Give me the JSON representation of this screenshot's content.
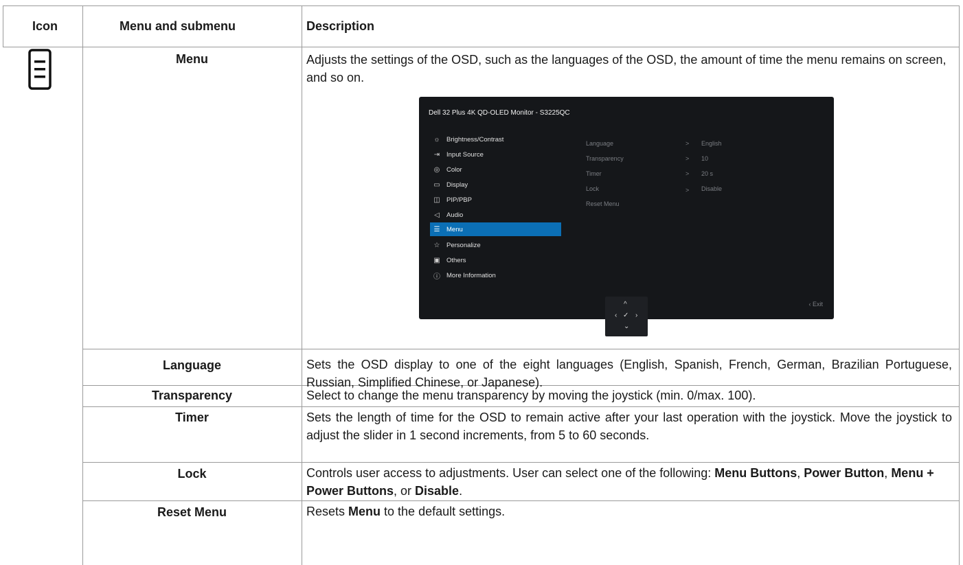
{
  "table": {
    "headers": {
      "icon": "Icon",
      "menu": "Menu and submenu",
      "description": "Description"
    },
    "menu_row": {
      "label": "Menu",
      "icon": "menu-list-icon",
      "description": "Adjusts the settings of the OSD, such as the languages of the OSD, the amount of time the menu remains on screen, and so on."
    },
    "rows": [
      {
        "label": "Language",
        "description": "Sets the OSD display to one of the eight languages (English, Spanish, French, German, Brazilian Portuguese, Russian, Simplified Chinese, or Japanese)."
      },
      {
        "label": "Transparency",
        "description": "Select to change the menu transparency by moving the joystick (min. 0/max. 100)."
      },
      {
        "label": "Timer",
        "description": "Sets the length of time for the OSD to remain active after your last operation with the joystick. Move the joystick to adjust the slider in 1 second increments, from 5 to 60 seconds."
      },
      {
        "label": "Lock",
        "description_pre": "Controls user access to adjustments. User can select one of the following: ",
        "opt1": "Menu Buttons",
        "sep1": ", ",
        "opt2": "Power Button",
        "sep2": ", ",
        "opt3": "Menu + Power Buttons",
        "sep3": ", or ",
        "opt4": "Disable",
        "end": "."
      },
      {
        "label": "Reset Menu",
        "description_pre": "Resets ",
        "bold": "Menu",
        "description_post": " to the default settings."
      }
    ]
  },
  "osd": {
    "title": "Dell 32 Plus 4K QD-OLED Monitor - S3225QC",
    "items": [
      {
        "label": "Brightness/Contrast",
        "icon": "brightness-icon"
      },
      {
        "label": "Input Source",
        "icon": "input-source-icon"
      },
      {
        "label": "Color",
        "icon": "color-icon"
      },
      {
        "label": "Display",
        "icon": "display-icon"
      },
      {
        "label": "PIP/PBP",
        "icon": "pip-pbp-icon"
      },
      {
        "label": "Audio",
        "icon": "audio-icon"
      },
      {
        "label": "Menu",
        "icon": "menu-icon",
        "selected": true
      },
      {
        "label": "Personalize",
        "icon": "star-icon"
      },
      {
        "label": "Others",
        "icon": "others-icon"
      },
      {
        "label": "More Information",
        "icon": "info-icon"
      }
    ],
    "submenu": [
      {
        "label": "Language",
        "value": "English"
      },
      {
        "label": "Transparency",
        "value": "10"
      },
      {
        "label": "Timer",
        "value": "20 s"
      },
      {
        "label": "Lock",
        "value": "Disable"
      },
      {
        "label": "Reset Menu",
        "value": ""
      }
    ],
    "chevron": ">",
    "exit": "‹ Exit",
    "selection_color": "#0b6fb5",
    "joystick": {
      "up": "^",
      "left": "‹",
      "center": "✓",
      "right": "›",
      "down": "⌄"
    }
  }
}
